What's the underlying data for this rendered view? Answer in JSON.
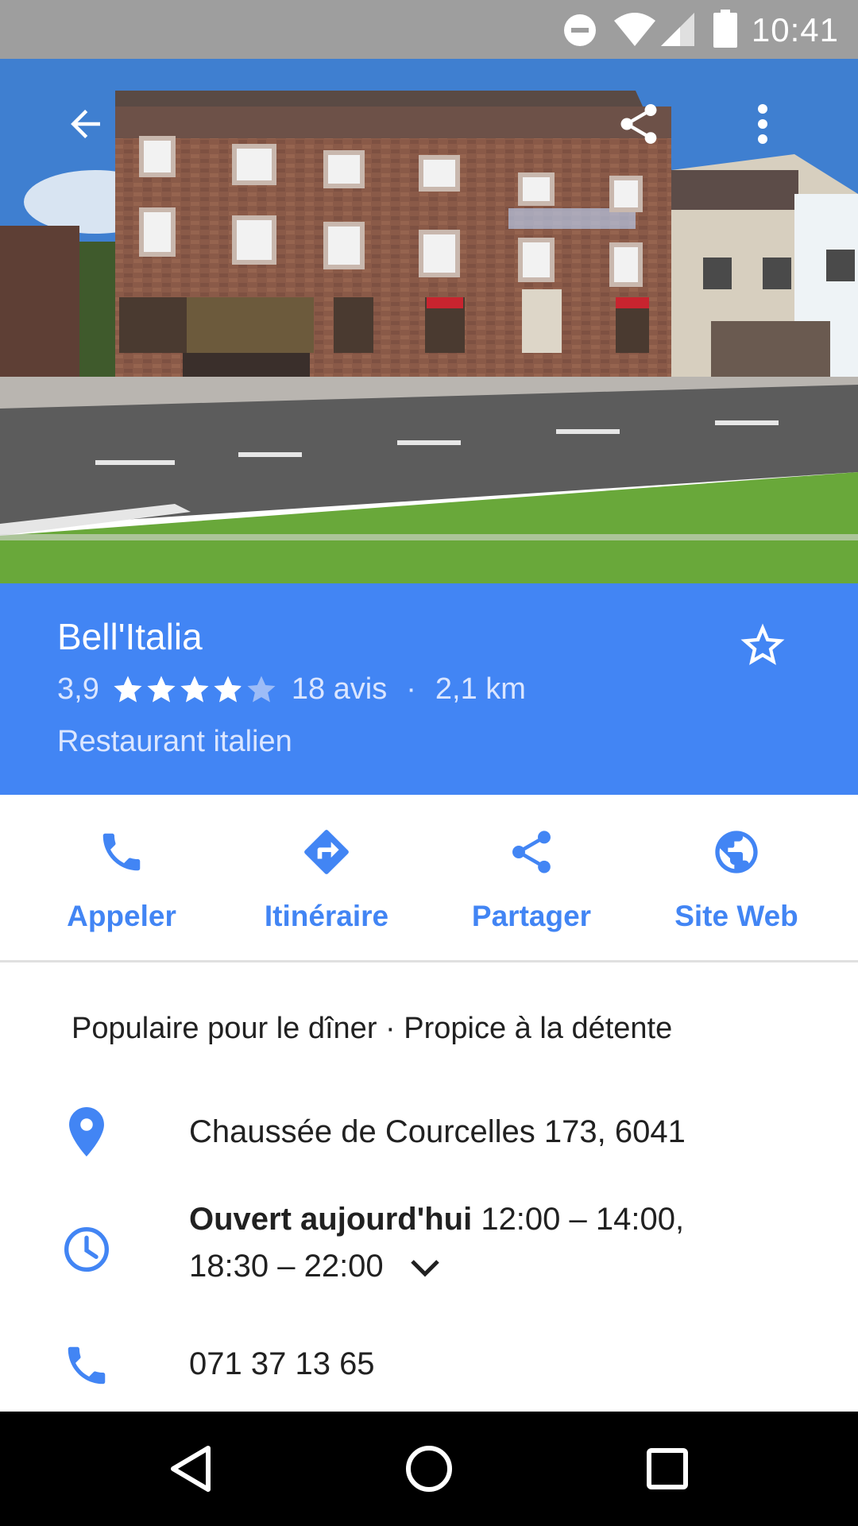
{
  "status_bar": {
    "time": "10:41",
    "icons": [
      "do-not-disturb-icon",
      "wifi-icon",
      "signal-icon",
      "battery-icon"
    ]
  },
  "hero": {
    "icons": [
      "back-arrow-icon",
      "share-icon",
      "more-vert-icon"
    ]
  },
  "place": {
    "name": "Bell'Italia",
    "rating": "3,9",
    "rating_value": 3.9,
    "rating_max": 5,
    "reviews": "18 avis",
    "separator": "·",
    "distance": "2,1 km",
    "category": "Restaurant italien"
  },
  "actions": [
    {
      "label": "Appeler",
      "icon": "phone-icon"
    },
    {
      "label": "Itinéraire",
      "icon": "directions-icon"
    },
    {
      "label": "Partager",
      "icon": "share-icon"
    },
    {
      "label": "Site Web",
      "icon": "globe-icon"
    }
  ],
  "details": {
    "popular": "Populaire pour le dîner · Propice à la détente",
    "address": "Chaussée de Courcelles 173, 6041",
    "hours_status": "Ouvert aujourd'hui",
    "hours_line1": " 12:00 – 14:00,",
    "hours_line2": "18:30 – 22:00",
    "phone": "071 37 13 65"
  },
  "colors": {
    "accent": "#4285f4",
    "status_bar": "#9e9e9e",
    "nav_bar": "#000000"
  }
}
